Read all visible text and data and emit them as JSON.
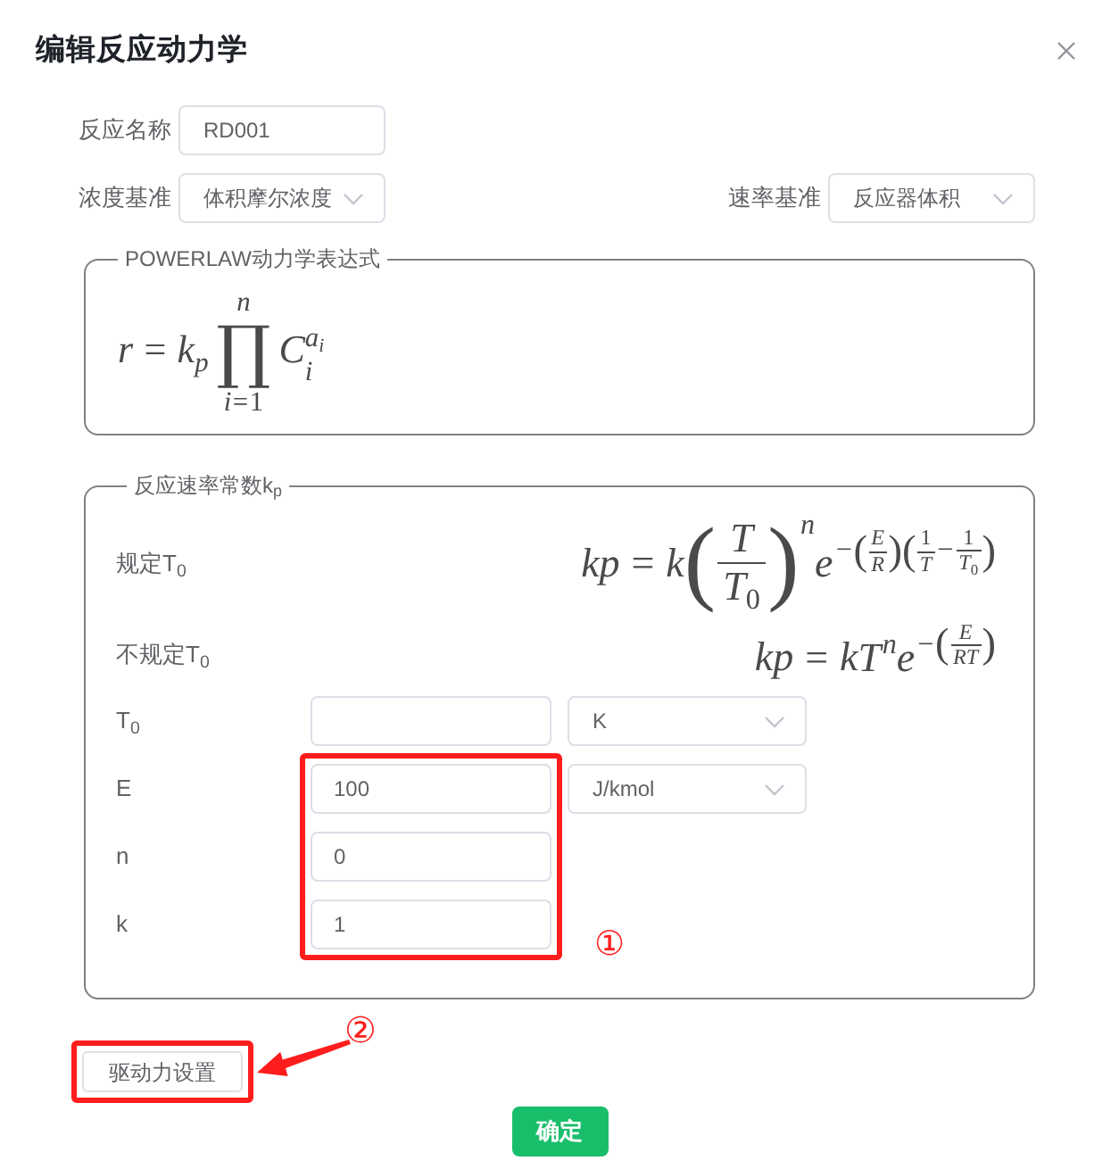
{
  "dialog": {
    "title": "编辑反应动力学"
  },
  "form": {
    "reaction_name": {
      "label": "反应名称",
      "value": "RD001"
    },
    "concentration_basis": {
      "label": "浓度基准",
      "value": "体积摩尔浓度"
    },
    "rate_basis": {
      "label": "速率基准",
      "value": "反应器体积"
    }
  },
  "powerlaw_panel": {
    "title": "POWERLAW动力学表达式",
    "formula": [
      {
        "kind": "ident",
        "text": "r"
      },
      {
        "kind": "op",
        "text": "="
      },
      {
        "kind": "script",
        "base": [
          {
            "kind": "ident",
            "text": "k"
          }
        ],
        "sub": [
          {
            "kind": "ident",
            "text": "p"
          }
        ]
      },
      {
        "kind": "bigop",
        "symbol": "∏",
        "upper": [
          {
            "kind": "ident",
            "text": "n"
          }
        ],
        "lower": [
          {
            "kind": "ident",
            "text": "i"
          },
          {
            "kind": "op",
            "text": "="
          },
          {
            "kind": "num",
            "text": "1"
          }
        ]
      },
      {
        "kind": "script",
        "base": [
          {
            "kind": "ident",
            "text": "C"
          }
        ],
        "sub": [
          {
            "kind": "ident",
            "text": "i"
          }
        ],
        "sup": [
          {
            "kind": "script",
            "base": [
              {
                "kind": "ident",
                "text": "a"
              }
            ],
            "sub": [
              {
                "kind": "ident",
                "text": "i"
              }
            ]
          }
        ]
      }
    ]
  },
  "rate_constant_panel": {
    "title": "反应速率常数k$_{p}$",
    "formulas": [
      {
        "label": "规定T$_{0}$",
        "formula": [
          {
            "kind": "ident",
            "text": "kp"
          },
          {
            "kind": "op",
            "text": "="
          },
          {
            "kind": "ident",
            "text": "k"
          },
          {
            "kind": "script",
            "base": [
              {
                "kind": "paren",
                "open": "(",
                "close": ")",
                "body": [
                  {
                    "kind": "frac",
                    "num": [
                      {
                        "kind": "ident",
                        "text": "T"
                      }
                    ],
                    "den": [
                      {
                        "kind": "script",
                        "base": [
                          {
                            "kind": "ident",
                            "text": "T"
                          }
                        ],
                        "sub": [
                          {
                            "kind": "num",
                            "text": "0"
                          }
                        ]
                      }
                    ]
                  }
                ]
              }
            ],
            "sup": [
              {
                "kind": "ident",
                "text": "n"
              }
            ]
          },
          {
            "kind": "script",
            "base": [
              {
                "kind": "ident",
                "text": "e"
              }
            ],
            "sup": [
              {
                "kind": "op",
                "text": "−"
              },
              {
                "kind": "paren",
                "open": "(",
                "close": ")",
                "body": [
                  {
                    "kind": "frac",
                    "num": [
                      {
                        "kind": "ident",
                        "text": "E"
                      }
                    ],
                    "den": [
                      {
                        "kind": "ident",
                        "text": "R"
                      }
                    ]
                  }
                ]
              },
              {
                "kind": "paren",
                "open": "(",
                "close": ")",
                "body": [
                  {
                    "kind": "frac",
                    "num": [
                      {
                        "kind": "num",
                        "text": "1"
                      }
                    ],
                    "den": [
                      {
                        "kind": "ident",
                        "text": "T"
                      }
                    ]
                  },
                  {
                    "kind": "op",
                    "text": "−"
                  },
                  {
                    "kind": "frac",
                    "num": [
                      {
                        "kind": "num",
                        "text": "1"
                      }
                    ],
                    "den": [
                      {
                        "kind": "script",
                        "base": [
                          {
                            "kind": "ident",
                            "text": "T"
                          }
                        ],
                        "sub": [
                          {
                            "kind": "num",
                            "text": "0"
                          }
                        ]
                      }
                    ]
                  }
                ]
              }
            ]
          }
        ]
      },
      {
        "label": "不规定T$_{0}$",
        "formula": [
          {
            "kind": "ident",
            "text": "kp"
          },
          {
            "kind": "op",
            "text": "="
          },
          {
            "kind": "ident",
            "text": "k"
          },
          {
            "kind": "script",
            "base": [
              {
                "kind": "ident",
                "text": "T"
              }
            ],
            "sup": [
              {
                "kind": "ident",
                "text": "n"
              }
            ]
          },
          {
            "kind": "script",
            "base": [
              {
                "kind": "ident",
                "text": "e"
              }
            ],
            "sup": [
              {
                "kind": "op",
                "text": "−"
              },
              {
                "kind": "paren",
                "open": "(",
                "close": ")",
                "body": [
                  {
                    "kind": "frac",
                    "num": [
                      {
                        "kind": "ident",
                        "text": "E"
                      }
                    ],
                    "den": [
                      {
                        "kind": "ident",
                        "text": "RT"
                      }
                    ]
                  }
                ]
              }
            ]
          }
        ]
      }
    ],
    "parameters": [
      {
        "label": "T$_{0}$",
        "unit": "K",
        "highlighted": false
      },
      {
        "label": "E",
        "value": "100",
        "unit": "J/kmol",
        "highlighted": true
      },
      {
        "label": "n",
        "value": "0",
        "highlighted": true
      },
      {
        "label": "k",
        "value": "1",
        "highlighted": true
      }
    ],
    "callout": "①"
  },
  "driving_force_button": {
    "label": "驱动力设置",
    "highlighted": true,
    "callout": "②"
  },
  "confirm_button": {
    "label": "确定"
  }
}
